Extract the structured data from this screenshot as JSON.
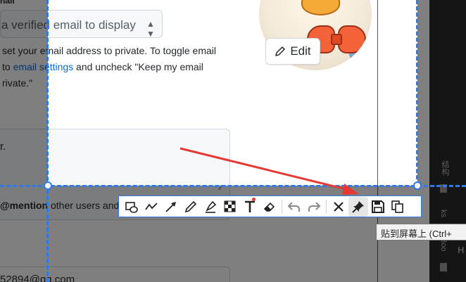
{
  "profile": {
    "label_cut": "nail",
    "email_select": "a verified email to display",
    "privacy_note": {
      "line1": "set your email address to private. To toggle email",
      "line2_prefix": "to ",
      "line2_link": "email settings",
      "line2_suffix": " and uncheck \"Keep my email",
      "line3": "rivate.\""
    },
    "edit_button": "Edit",
    "bio_value": "r.",
    "mention_hint_bold": "@mention",
    "mention_hint_rest": " other users and",
    "email_value": "52894@qq.com"
  },
  "side_panel": {
    "label_1": "结构",
    "label_2": "Boo",
    "label_3": "ks",
    "h": "H"
  },
  "toolbar": {
    "tools": [
      {
        "name": "rectangle-tool",
        "icon": "rect-ellipse-icon"
      },
      {
        "name": "curve-tool",
        "icon": "curve-icon"
      },
      {
        "name": "arrow-tool",
        "icon": "arrow-icon"
      },
      {
        "name": "pen-tool",
        "icon": "pencil-icon"
      },
      {
        "name": "marker-tool",
        "icon": "highlighter-icon"
      },
      {
        "name": "mosaic-tool",
        "icon": "mosaic-icon"
      },
      {
        "name": "text-tool",
        "icon": "text-icon"
      },
      {
        "name": "eraser-tool",
        "icon": "eraser-icon"
      },
      {
        "name": "undo-button",
        "icon": "undo-icon"
      },
      {
        "name": "redo-button",
        "icon": "redo-icon"
      },
      {
        "name": "cancel-button",
        "icon": "close-icon"
      },
      {
        "name": "pin-button",
        "icon": "pin-icon"
      },
      {
        "name": "save-button",
        "icon": "save-icon"
      },
      {
        "name": "copy-button",
        "icon": "copy-icon"
      }
    ],
    "tooltip": "贴到屏幕上 (Ctrl+"
  },
  "colors": {
    "selection": "#2f7ae5",
    "annotation_arrow": "#e53935",
    "link": "#0969da"
  }
}
